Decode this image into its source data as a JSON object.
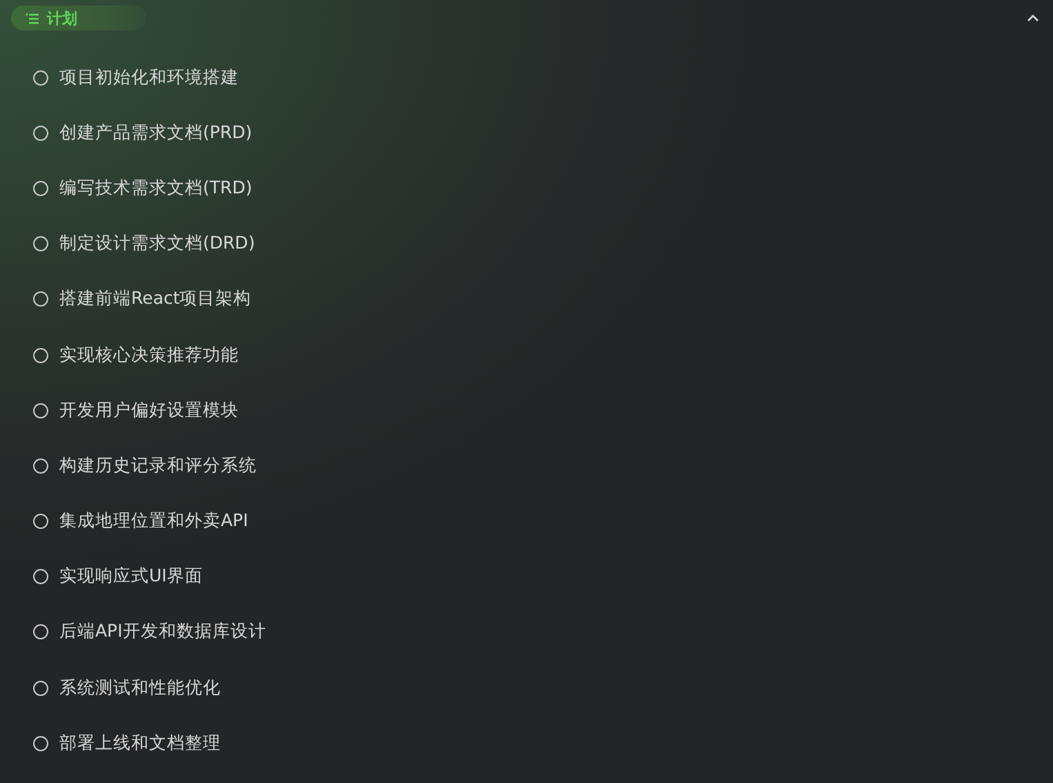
{
  "section": {
    "title": "计划",
    "expanded": true
  },
  "tasks": [
    {
      "label": "项目初始化和环境搭建",
      "checked": false
    },
    {
      "label": "创建产品需求文档(PRD)",
      "checked": false
    },
    {
      "label": "编写技术需求文档(TRD)",
      "checked": false
    },
    {
      "label": "制定设计需求文档(DRD)",
      "checked": false
    },
    {
      "label": "搭建前端React项目架构",
      "checked": false
    },
    {
      "label": "实现核心决策推荐功能",
      "checked": false
    },
    {
      "label": "开发用户偏好设置模块",
      "checked": false
    },
    {
      "label": "构建历史记录和评分系统",
      "checked": false
    },
    {
      "label": "集成地理位置和外卖API",
      "checked": false
    },
    {
      "label": "实现响应式UI界面",
      "checked": false
    },
    {
      "label": "后端API开发和数据库设计",
      "checked": false
    },
    {
      "label": "系统测试和性能优化",
      "checked": false
    },
    {
      "label": "部署上线和文档整理",
      "checked": false
    }
  ]
}
